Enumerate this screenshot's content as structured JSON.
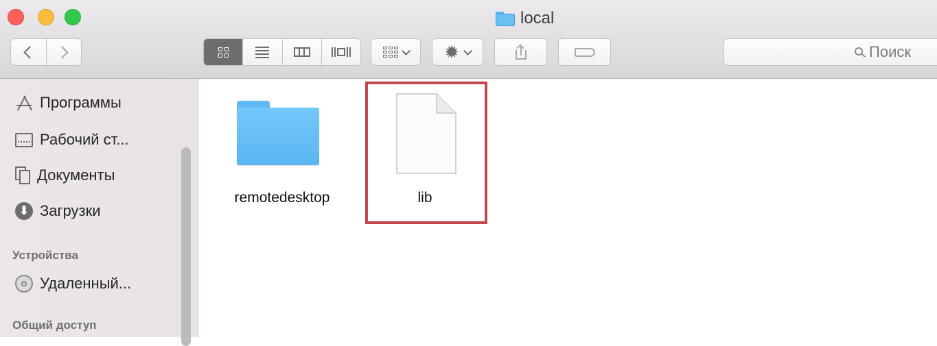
{
  "window": {
    "title": "local",
    "title_icon": "folder-icon"
  },
  "toolbar": {
    "back": {
      "icon": "chevron-left-icon"
    },
    "forward": {
      "icon": "chevron-right-icon"
    },
    "views": [
      {
        "name": "icon-view",
        "icon": "grid-icon",
        "active": true
      },
      {
        "name": "list-view",
        "icon": "list-icon",
        "active": false
      },
      {
        "name": "column-view",
        "icon": "columns-icon",
        "active": false
      },
      {
        "name": "cover-flow-view",
        "icon": "coverflow-icon",
        "active": false
      }
    ],
    "arrange": {
      "icon": "arrange-icon"
    },
    "action": {
      "icon": "gear-icon",
      "glyph": "✹"
    },
    "share": {
      "icon": "share-icon"
    },
    "tags": {
      "icon": "tag-icon"
    },
    "search": {
      "placeholder": "Поиск",
      "icon": "search-icon"
    }
  },
  "sidebar": {
    "favorites": [
      {
        "label": "Программы",
        "icon": "apps-icon"
      },
      {
        "label": "Рабочий ст...",
        "icon": "desktop-icon"
      },
      {
        "label": "Документы",
        "icon": "documents-icon"
      },
      {
        "label": "Загрузки",
        "icon": "downloads-icon",
        "glyph": "⬇"
      }
    ],
    "devices_header": "Устройства",
    "devices": [
      {
        "label": "Удаленный...",
        "icon": "disc-icon"
      }
    ],
    "shared_header": "Общий доступ"
  },
  "content": {
    "items": [
      {
        "label": "remotedesktop",
        "icon": "folder-icon",
        "selected": false
      },
      {
        "label": "lib",
        "icon": "file-icon",
        "selected": true
      }
    ],
    "highlight_color": "#c0474b"
  },
  "colors": {
    "close": "#fc605b",
    "minimize": "#fdbc40",
    "maximize": "#34c84a",
    "folder": "#69c0f4"
  }
}
